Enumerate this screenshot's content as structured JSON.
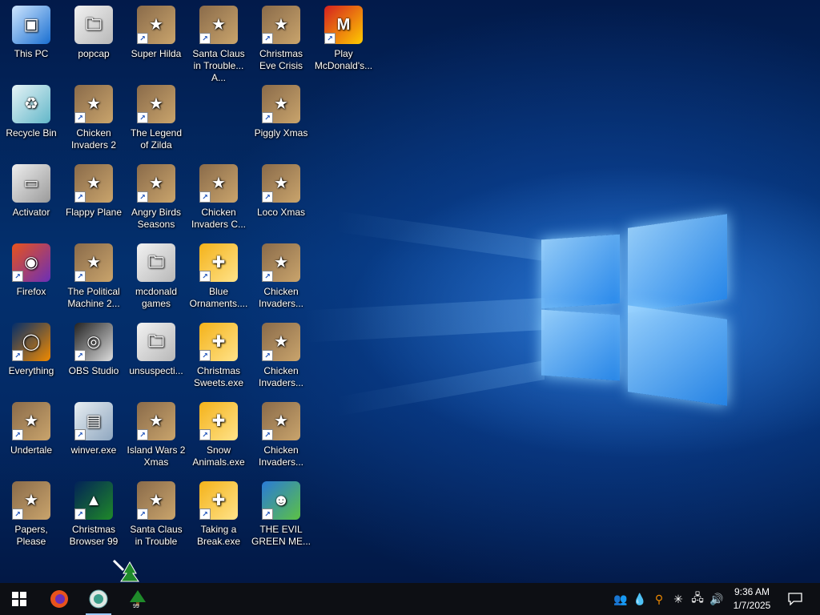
{
  "desktop": {
    "icons": [
      {
        "label": "This PC",
        "icon": "computer-icon",
        "shortcut": false
      },
      {
        "label": "popcap",
        "icon": "folder-icon",
        "shortcut": false
      },
      {
        "label": "Super Hilda",
        "icon": "game-icon",
        "shortcut": true
      },
      {
        "label": "Santa Claus in Trouble... A...",
        "icon": "game-icon",
        "shortcut": true
      },
      {
        "label": "Christmas Eve Crisis",
        "icon": "game-icon",
        "shortcut": true
      },
      {
        "label": "Play McDonald's...",
        "icon": "mcdonalds-icon",
        "shortcut": true
      },
      {
        "label": "Recycle Bin",
        "icon": "recycle-bin-icon",
        "shortcut": false
      },
      {
        "label": "Chicken Invaders 2",
        "icon": "game-icon",
        "shortcut": true
      },
      {
        "label": "The Legend of Zilda",
        "icon": "game-icon",
        "shortcut": true
      },
      {
        "label": "Piggly Xmas",
        "icon": "game-icon",
        "shortcut": true
      },
      {
        "label": "Activator",
        "icon": "file-icon",
        "shortcut": false
      },
      {
        "label": "Flappy Plane",
        "icon": "game-icon",
        "shortcut": true
      },
      {
        "label": "Angry Birds Seasons",
        "icon": "game-icon",
        "shortcut": true
      },
      {
        "label": "Chicken Invaders C...",
        "icon": "game-icon",
        "shortcut": true
      },
      {
        "label": "Loco Xmas",
        "icon": "game-icon",
        "shortcut": true
      },
      {
        "label": "Firefox",
        "icon": "firefox-icon",
        "shortcut": true
      },
      {
        "label": "The Political Machine 2...",
        "icon": "game-icon",
        "shortcut": true
      },
      {
        "label": "mcdonald games",
        "icon": "folder-icon",
        "shortcut": false
      },
      {
        "label": "Blue Ornaments....",
        "icon": "app-icon",
        "shortcut": true
      },
      {
        "label": "Chicken Invaders...",
        "icon": "game-icon",
        "shortcut": true
      },
      {
        "label": "Everything",
        "icon": "search-icon",
        "shortcut": true
      },
      {
        "label": "OBS Studio",
        "icon": "obs-icon",
        "shortcut": true
      },
      {
        "label": "unsuspecti...",
        "icon": "folder-icon",
        "shortcut": false
      },
      {
        "label": "Christmas Sweets.exe",
        "icon": "app-icon",
        "shortcut": true
      },
      {
        "label": "Chicken Invaders...",
        "icon": "game-icon",
        "shortcut": true
      },
      {
        "label": "Undertale",
        "icon": "game-icon",
        "shortcut": true
      },
      {
        "label": "winver.exe",
        "icon": "window-icon",
        "shortcut": true
      },
      {
        "label": "Island Wars 2 Xmas",
        "icon": "game-icon",
        "shortcut": true
      },
      {
        "label": "Snow Animals.exe",
        "icon": "app-icon",
        "shortcut": true
      },
      {
        "label": "Chicken Invaders...",
        "icon": "game-icon",
        "shortcut": true
      },
      {
        "label": "Papers, Please",
        "icon": "game-icon",
        "shortcut": true
      },
      {
        "label": "Christmas Browser 99",
        "icon": "christmas-tree-icon",
        "shortcut": true
      },
      {
        "label": "Santa Claus in Trouble",
        "icon": "game-icon",
        "shortcut": true
      },
      {
        "label": "Taking a Break.exe",
        "icon": "app-icon",
        "shortcut": true
      },
      {
        "label": "THE EVIL GREEN ME...",
        "icon": "messenger-icon",
        "shortcut": true
      }
    ]
  },
  "taskbar": {
    "pinned": [
      {
        "name": "firefox",
        "icon": "firefox-icon"
      },
      {
        "name": "app",
        "icon": "globe-icon"
      },
      {
        "name": "christmas-browser",
        "icon": "christmas-tree-icon"
      }
    ],
    "clock": {
      "time": "9:36 AM",
      "date": "1/7/2025"
    },
    "tray": [
      "people-icon",
      "drop-icon",
      "search-icon",
      "snowflake-icon",
      "network-icon",
      "volume-icon"
    ],
    "accent": "#9ac8ff"
  }
}
